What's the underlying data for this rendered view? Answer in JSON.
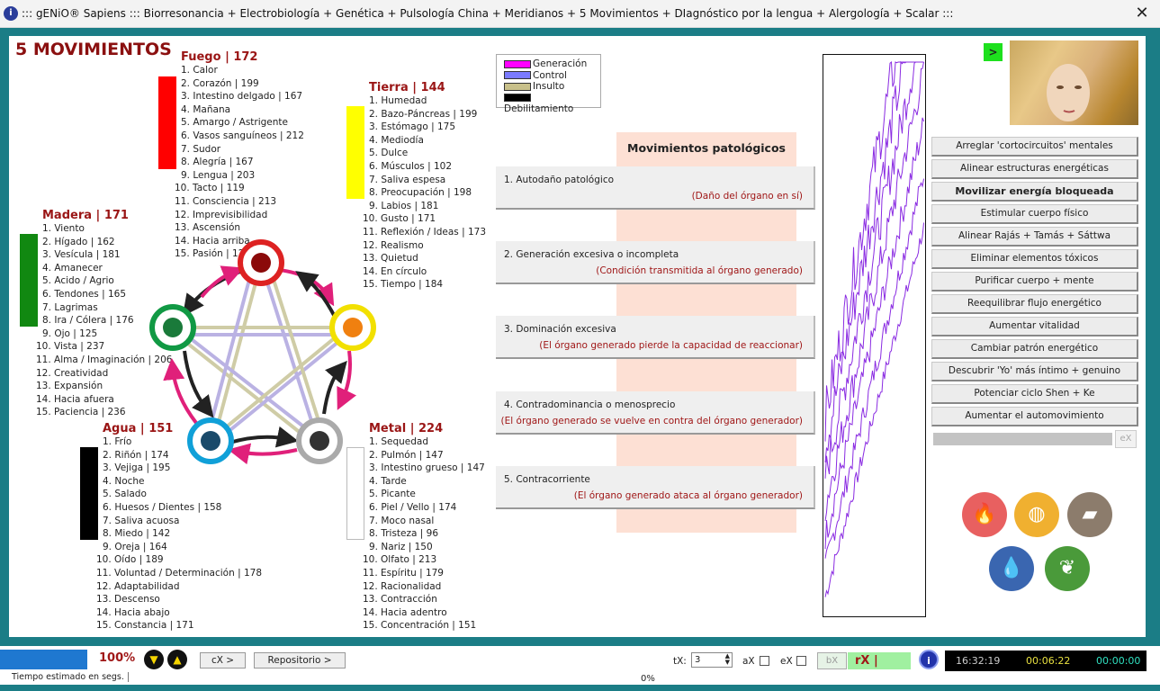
{
  "window": {
    "title": "::: gENiO® Sapiens ::: Biorresonancia + Electrobiología + Genética + Pulsología China + Meridianos + 5 Movimientos + DIagnóstico por la lengua + Alergología + Scalar :::",
    "close": "✕",
    "icon": "i"
  },
  "main_title": "5 MOVIMIENTOS",
  "elements": {
    "fuego": {
      "title": "Fuego | 172",
      "color": "#ff0000",
      "items": [
        "1. Calor",
        "2. Corazón | 199",
        "3. Intestino delgado | 167",
        "4. Mañana",
        "5. Amargo / Astrigente",
        "6. Vasos sanguíneos | 212",
        "7. Sudor",
        "8. Alegría | 167",
        "9. Lengua | 203",
        "10. Tacto | 119",
        "11. Consciencia | 213",
        "12. Imprevisibilidad",
        "13. Ascensión",
        "14. Hacia arriba",
        "15. Pasión | 120"
      ]
    },
    "tierra": {
      "title": "Tierra | 144",
      "color": "#ffff00",
      "items": [
        "1. Humedad",
        "2. Bazo-Páncreas | 199",
        "3. Estómago | 175",
        "4. Mediodía",
        "5. Dulce",
        "6. Músculos | 102",
        "7. Saliva espesa",
        "8. Preocupación | 198",
        "9. Labios | 181",
        "10. Gusto | 171",
        "11. Reflexión / Ideas | 173",
        "12. Realismo",
        "13. Quietud",
        "14. En círculo",
        "15. Tiempo | 184"
      ]
    },
    "madera": {
      "title": "Madera | 171",
      "color": "#118811",
      "items": [
        "1. Viento",
        "2. Hígado | 162",
        "3. Vesícula | 181",
        "4. Amanecer",
        "5. Acido / Agrio",
        "6. Tendones | 165",
        "7. Lagrimas",
        "8. Ira / Cólera | 176",
        "9. Ojo | 125",
        "10. Vista | 237",
        "11. Alma / Imaginación | 206",
        "12. Creatividad",
        "13. Expansión",
        "14. Hacia afuera",
        "15. Paciencia | 236"
      ]
    },
    "agua": {
      "title": "Agua | 151",
      "color": "#000000",
      "items": [
        "1. Frío",
        "2. Riñón | 174",
        "3. Vejiga | 195",
        "4. Noche",
        "5. Salado",
        "6. Huesos / Dientes | 158",
        "7. Saliva acuosa",
        "8. Miedo | 142",
        "9. Oreja | 164",
        "10. Oído | 189",
        "11. Voluntad / Determinación | 178",
        "12. Adaptabilidad",
        "13. Descenso",
        "14. Hacia abajo",
        "15. Constancia | 171"
      ]
    },
    "metal": {
      "title": "Metal | 224",
      "color": "#ffffff",
      "items": [
        "1. Sequedad",
        "2. Pulmón | 147",
        "3. Intestino grueso | 147",
        "4. Tarde",
        "5. Picante",
        "6. Piel / Vello | 174",
        "7. Moco nasal",
        "8. Tristeza | 96",
        "9. Nariz | 150",
        "10. Olfato | 213",
        "11. Espíritu | 179",
        "12. Racionalidad",
        "13. Contracción",
        "14. Hacia adentro",
        "15. Concentración | 151"
      ]
    }
  },
  "legend": [
    {
      "label": "Generación",
      "color": "#ff00ff"
    },
    {
      "label": "Control",
      "color": "#7a7aff"
    },
    {
      "label": "Insulto",
      "color": "#c8c08a"
    },
    {
      "label": "Debilitamiento",
      "color": "#000000"
    }
  ],
  "pathological": {
    "title": "Movimientos patológicos",
    "items": [
      {
        "name": "1. Autodaño patológico",
        "desc": "(Daño del órgano en sí)"
      },
      {
        "name": "2. Generación excesiva o incompleta",
        "desc": "(Condición transmitida al órgano generado)"
      },
      {
        "name": "3. Dominación excesiva",
        "desc": "(El órgano generado pierde la capacidad de reaccionar)"
      },
      {
        "name": "4. Contradominancia o menosprecio",
        "desc": "(El órgano generado se vuelve en contra del órgano generador)"
      },
      {
        "name": "5. Contracorriente",
        "desc": "(El órgano generado ataca al órgano generador)"
      }
    ]
  },
  "right": {
    "go": ">",
    "buttons": [
      "Arreglar 'cortocircuitos' mentales",
      "Alinear estructuras energéticas",
      "Movilizar energía bloqueada",
      "Estimular cuerpo físico",
      "Alinear Rajás + Tamás + Sáttwa",
      "Eliminar elementos tóxicos",
      "Purificar cuerpo + mente",
      "Reequilibrar flujo energético",
      "Aumentar vitalidad",
      "Cambiar patrón energético",
      "Descubrir 'Yo' más íntimo + genuino",
      "Potenciar ciclo Shen + Ke",
      "Aumentar el automovimiento"
    ],
    "ex": "eX",
    "progress": 0
  },
  "bottom": {
    "progress_pct": "100%",
    "progress": 1.0,
    "cx": "cX >",
    "repo": "Repositorio >",
    "tiempo": "Tiempo estimado en segs.",
    "zero": "0%",
    "tx_label": "tX:",
    "tx_value": "3",
    "ax": "aX",
    "ex": "eX",
    "bx": "bX",
    "rx": "rX |",
    "clock": {
      "time": "16:32:19",
      "elapsed": "00:06:22",
      "remaining": "00:00:00"
    }
  }
}
